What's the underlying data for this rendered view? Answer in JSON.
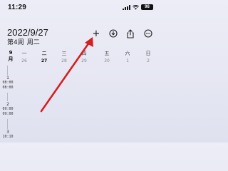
{
  "status_bar": {
    "time": "11:29",
    "battery": "98"
  },
  "header": {
    "date": "2022/9/27",
    "week_label": "第4周",
    "weekday_label": "周二"
  },
  "toolbar": {
    "add_label": "+"
  },
  "month_label": {
    "line1": "9",
    "line2": "月"
  },
  "week_days": [
    {
      "name": "一",
      "num": "26"
    },
    {
      "name": "二",
      "num": "27"
    },
    {
      "name": "三",
      "num": "28"
    },
    {
      "name": "四",
      "num": "29"
    },
    {
      "name": "五",
      "num": "30"
    },
    {
      "name": "六",
      "num": "1"
    },
    {
      "name": "日",
      "num": "2"
    }
  ],
  "timeline": [
    {
      "day": "1",
      "times": [
        "08:00",
        "08:00"
      ]
    },
    {
      "day": "2",
      "times": [
        "09:00",
        "09:00"
      ]
    },
    {
      "day": "3",
      "times": [
        "10:10"
      ]
    }
  ],
  "colors": {
    "arrow": "#d42020"
  }
}
